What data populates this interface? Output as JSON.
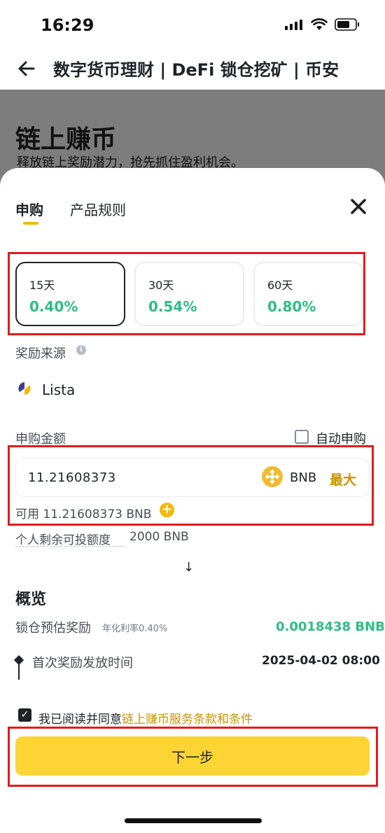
{
  "status_bar": {
    "time": "16:29"
  },
  "nav": {
    "title": "数字货币理财 | DeFi 锁仓挖矿 | 币安"
  },
  "banner": {
    "title": "链上赚币",
    "subtitle": "释放链上奖励潜力，抢先抓住盈利机会。"
  },
  "tabs": [
    {
      "label": "申购",
      "active": true
    },
    {
      "label": "产品规则",
      "active": false
    }
  ],
  "durations": [
    {
      "days": "15天",
      "rate": "0.40%",
      "selected": true
    },
    {
      "days": "30天",
      "rate": "0.54%",
      "selected": false
    },
    {
      "days": "60天",
      "rate": "0.80%",
      "selected": false
    }
  ],
  "reward_source": {
    "label": "奖励来源",
    "provider": "Lista"
  },
  "amount": {
    "label": "申购金额",
    "auto_label": "自动申购",
    "value": "11.21608373",
    "asset": "BNB",
    "max_label": "最大",
    "available": "可用 11.21608373 BNB",
    "quota_label": "个人剩余可投额度",
    "quota_value": "2000 BNB"
  },
  "overview": {
    "title": "概览",
    "reward_label": "锁仓预估奖励",
    "reward_sub": "年化利率0.40%",
    "reward_value": "0.0018438 BNB",
    "first_label": "首次奖励发放时间",
    "first_value": "2025-04-02 08:00"
  },
  "agreement": {
    "text": "我已阅读并同意",
    "link": "链上赚币服务条款和条件",
    "checked": true
  },
  "next_button": "下一步",
  "colors": {
    "accent": "#f0b90b",
    "button": "#fcd535",
    "positive": "#2ebd85",
    "link": "#c99400",
    "highlight_box": "#e21b1b"
  }
}
